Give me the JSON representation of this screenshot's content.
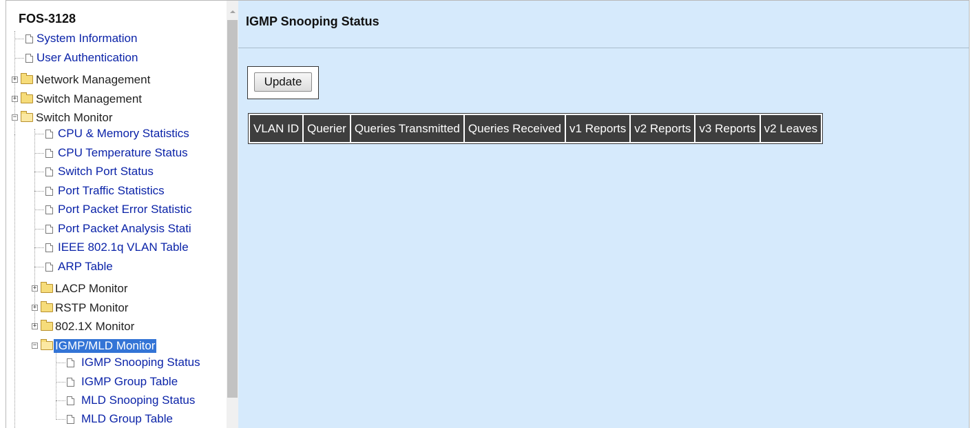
{
  "sidebar": {
    "device_title": "FOS-3128",
    "items": [
      {
        "label": "System Information",
        "type": "page"
      },
      {
        "label": "User Authentication",
        "type": "page"
      },
      {
        "label": "Network Management",
        "type": "folder",
        "expanded": false
      },
      {
        "label": "Switch Management",
        "type": "folder",
        "expanded": false
      },
      {
        "label": "Switch Monitor",
        "type": "folder",
        "expanded": true
      },
      {
        "label": "CPU & Memory Statistics",
        "type": "page"
      },
      {
        "label": "CPU Temperature Status",
        "type": "page"
      },
      {
        "label": "Switch Port Status",
        "type": "page"
      },
      {
        "label": "Port Traffic Statistics",
        "type": "page"
      },
      {
        "label": "Port Packet Error Statistic",
        "type": "page"
      },
      {
        "label": "Port Packet Analysis Stati",
        "type": "page"
      },
      {
        "label": "IEEE 802.1q VLAN Table",
        "type": "page"
      },
      {
        "label": "ARP Table",
        "type": "page"
      },
      {
        "label": "LACP Monitor",
        "type": "folder",
        "expanded": false
      },
      {
        "label": "RSTP Monitor",
        "type": "folder",
        "expanded": false
      },
      {
        "label": "802.1X Monitor",
        "type": "folder",
        "expanded": false
      },
      {
        "label": "IGMP/MLD Monitor",
        "type": "folder",
        "expanded": true,
        "selected": true
      },
      {
        "label": "IGMP Snooping Status",
        "type": "page"
      },
      {
        "label": "IGMP Group Table",
        "type": "page"
      },
      {
        "label": "MLD Snooping Status",
        "type": "page"
      },
      {
        "label": "MLD Group Table",
        "type": "page"
      }
    ]
  },
  "main": {
    "title": "IGMP Snooping Status",
    "update_label": "Update",
    "table_headers": [
      "VLAN ID",
      "Querier",
      "Queries Transmitted",
      "Queries Received",
      "v1 Reports",
      "v2 Reports",
      "v3 Reports",
      "v2 Leaves"
    ],
    "table_rows": []
  },
  "colors": {
    "link": "#0b23a8",
    "panel_background": "#d6eafc",
    "table_header": "#3e3e3e",
    "selection": "#3374d6"
  },
  "icons": {
    "page": "page-icon",
    "folder": "folder-icon",
    "folder_open": "folder-open-icon",
    "expand": "expand-plus-icon",
    "collapse": "collapse-minus-icon"
  }
}
